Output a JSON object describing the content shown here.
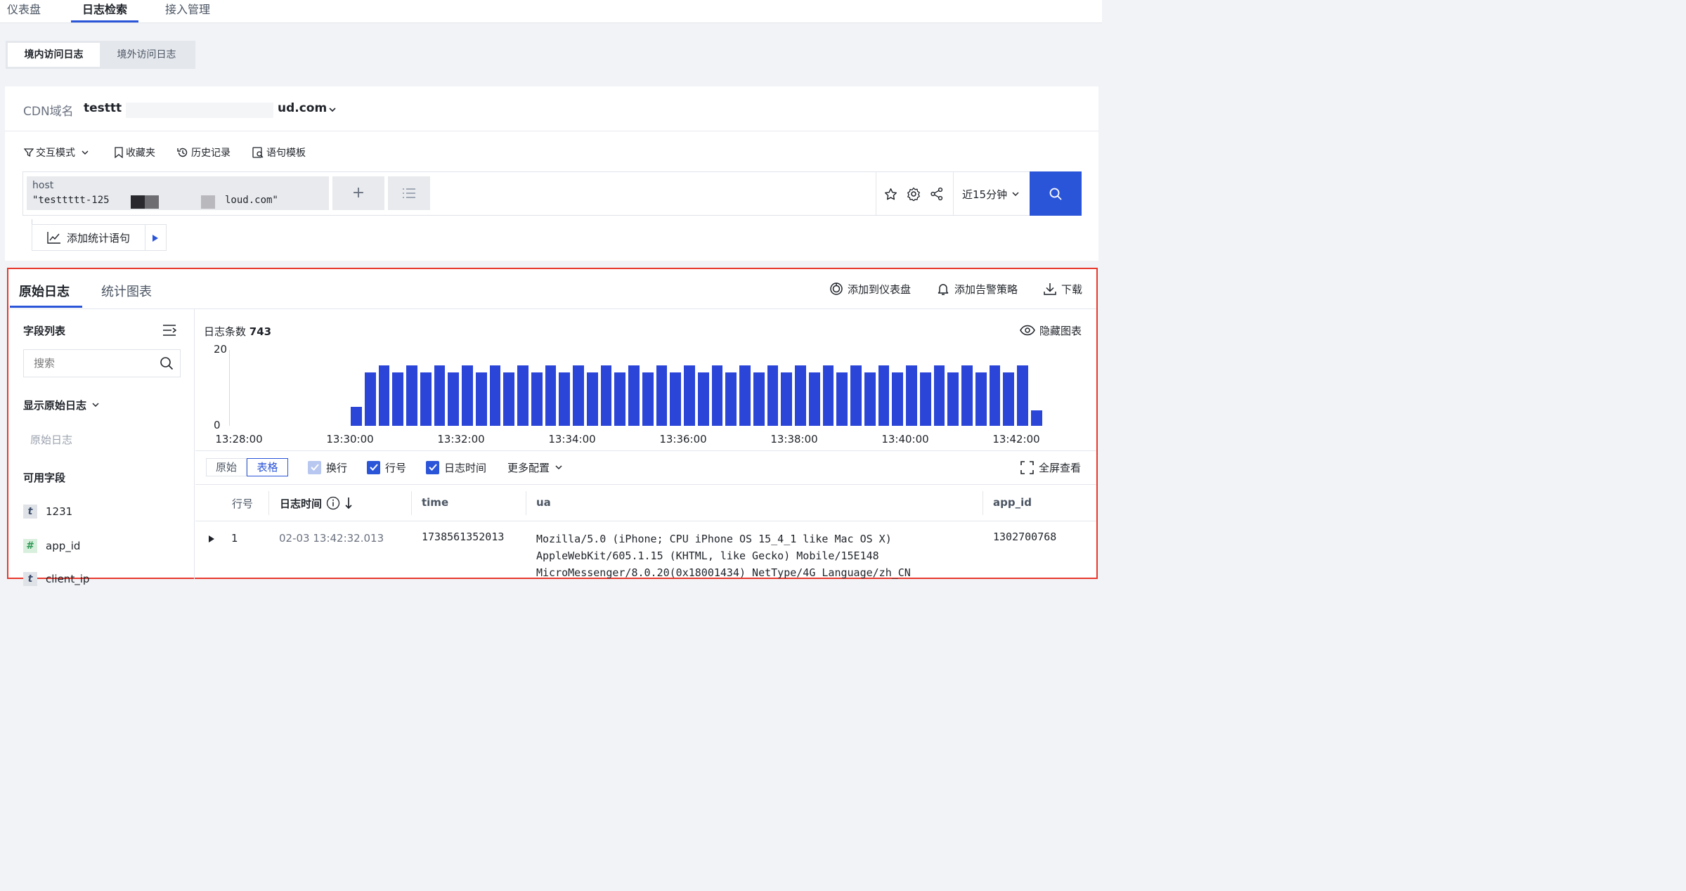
{
  "top_tabs": [
    "仪表盘",
    "日志检索",
    "接入管理"
  ],
  "sub_tabs": [
    "境内访问日志",
    "境外访问日志"
  ],
  "domain": {
    "label": "CDN域名",
    "value_prefix": "testtt",
    "value_suffix": "ud.com"
  },
  "toolbar": {
    "mode": "交互模式",
    "favorites": "收藏夹",
    "history": "历史记录",
    "template": "语句模板"
  },
  "query": {
    "key": "host",
    "value_prefix": "\"testtttt-125",
    "value_suffix": "loud.com\"",
    "add_symbol": "+"
  },
  "time_range": "近15分钟",
  "add_stat": "添加统计语句",
  "result_tabs": [
    "原始日志",
    "统计图表"
  ],
  "actions": {
    "dashboard": "添加到仪表盘",
    "alarm": "添加告警策略",
    "download": "下载"
  },
  "sidebar": {
    "title": "字段列表",
    "search_placeholder": "搜索",
    "show_raw": "显示原始日志",
    "raw_log": "原始日志",
    "available": "可用字段",
    "fields": [
      {
        "type": "t",
        "name": "1231"
      },
      {
        "type": "#",
        "name": "app_id"
      },
      {
        "type": "t",
        "name": "client_ip"
      }
    ]
  },
  "histogram": {
    "count_label": "日志条数",
    "count_value": "743",
    "hide_label": "隐藏图表"
  },
  "chart_data": {
    "type": "bar",
    "title": "",
    "xlabel": "",
    "ylabel": "",
    "ylim": [
      0,
      20
    ],
    "yticks": [
      "0",
      "20"
    ],
    "xticks": [
      "13:28:00",
      "13:30:00",
      "13:32:00",
      "13:34:00",
      "13:36:00",
      "13:38:00",
      "13:40:00",
      "13:42:00"
    ],
    "x_start": "13:30:00",
    "x_interval_seconds": 15,
    "values": [
      5,
      14,
      16,
      14,
      16,
      14,
      16,
      14,
      16,
      14,
      16,
      14,
      16,
      14,
      16,
      14,
      16,
      14,
      16,
      14,
      16,
      14,
      16,
      14,
      16,
      14,
      16,
      14,
      16,
      14,
      16,
      14,
      16,
      14,
      16,
      14,
      16,
      14,
      16,
      14,
      16,
      14,
      16,
      14,
      16,
      14,
      16,
      14,
      16,
      4
    ],
    "color": "#2b45d8",
    "grid": false
  },
  "view": {
    "raw": "原始",
    "table": "表格",
    "wrap": "换行",
    "line_no": "行号",
    "log_time": "日志时间",
    "more": "更多配置",
    "fullscreen": "全屏查看"
  },
  "table": {
    "headers": [
      "行号",
      "日志时间",
      "time",
      "ua",
      "app_id"
    ],
    "rows": [
      {
        "line": "1",
        "log_time": "02-03 13:42:32.013",
        "time": "1738561352013",
        "ua_lines": [
          "Mozilla/5.0 (iPhone; CPU iPhone OS 15_4_1 like Mac OS X)",
          "AppleWebKit/605.1.15 (KHTML, like Gecko) Mobile/15E148",
          "MicroMessenger/8.0.20(0x18001434) NetType/4G Language/zh_CN"
        ],
        "app_id": "1302700768"
      }
    ]
  },
  "colors": {
    "accent": "#2b55d8",
    "bar": "#2b45d8",
    "highlight_border": "#e8382c"
  }
}
